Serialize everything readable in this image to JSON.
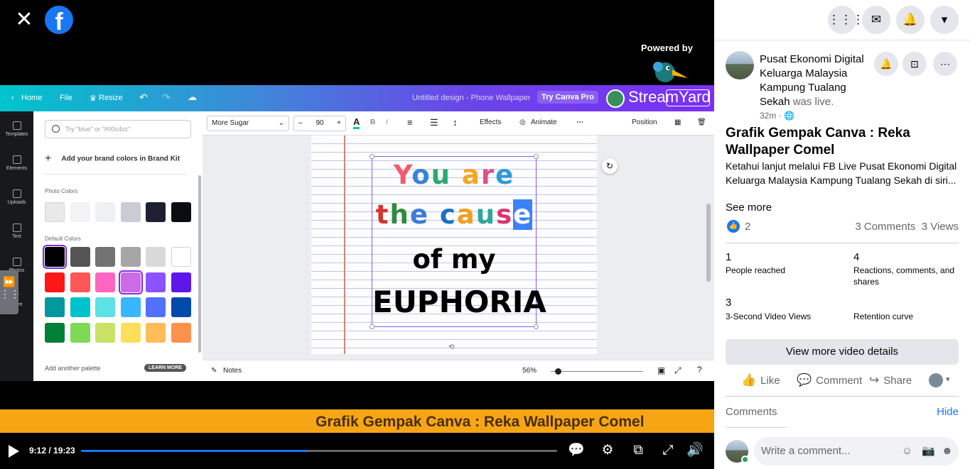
{
  "viewer": {
    "close_icon": "close-icon",
    "logo": "facebook-logo",
    "powered_by": "Powered by",
    "streamyard_text": "StreamYard"
  },
  "canva": {
    "home": "Home",
    "file": "File",
    "resize": "Resize",
    "doc_title": "Untitled design - Phone Wallpaper",
    "try_pro": "Try Canva Pro",
    "rail": [
      "Templates",
      "Elements",
      "Uploads",
      "Text",
      "Photos",
      "More"
    ],
    "search_placeholder": "Try \"blue\" or \"#00c4cc\"",
    "brand_kit": "Add your brand colors in Brand Kit",
    "photo_colors_label": "Photo Colors",
    "photo_colors": [
      "#e9e9ea",
      "#f3f3f5",
      "#eef0f2",
      "#cacbd4",
      "#1d2030",
      "#0b0b12"
    ],
    "default_colors_label": "Default Colors",
    "default_colors": [
      [
        "#000000",
        "#545454",
        "#737373",
        "#a6a6a6",
        "#d9d9d9",
        "#ffffff"
      ],
      [
        "#ff1616",
        "#ff5757",
        "#ff66c4",
        "#cb6ce6",
        "#8c52ff",
        "#5e17eb"
      ],
      [
        "#03989e",
        "#00c2cb",
        "#5ce1e6",
        "#38b6ff",
        "#5271ff",
        "#004aad"
      ],
      [
        "#008037",
        "#7ed957",
        "#c9e265",
        "#ffde59",
        "#ffbd59",
        "#ff914d"
      ]
    ],
    "selected_color": "#cb6ce6",
    "add_palette": "Add another palette",
    "learn_more": "LEARN MORE",
    "font_name": "More Sugar",
    "font_size": "90",
    "effects": "Effects",
    "animate": "Animate",
    "position": "Position",
    "notes": "Notes",
    "zoom": "56%",
    "text_lines": {
      "line1": [
        [
          "Y",
          "#f25a6b"
        ],
        [
          "o",
          "#3b82d6"
        ],
        [
          "u",
          "#2ba86e"
        ],
        [
          " ",
          "#000"
        ],
        [
          "a",
          "#f5a623"
        ],
        [
          "r",
          "#e04f8a"
        ],
        [
          "e",
          "#2d9bd6"
        ]
      ],
      "line2": [
        [
          "t",
          "#d6332a"
        ],
        [
          "h",
          "#2e8b3d"
        ],
        [
          "e",
          "#3b7bd6"
        ],
        [
          " ",
          "#000"
        ],
        [
          "c",
          "#1e6fc4"
        ],
        [
          "a",
          "#f0a020"
        ],
        [
          "u",
          "#2ca89a"
        ],
        [
          "s",
          "#d9386b"
        ]
      ],
      "line2_cursor": "e",
      "line3": "of my",
      "line4": "EUPHORIA"
    }
  },
  "banner": {
    "text": "Grafik Gempak Canva : Reka Wallpaper Comel",
    "color": "#f6a515"
  },
  "player": {
    "time": "9:12 / 19:23",
    "progress": 0.474
  },
  "topbar_icons": [
    "menu-grid-icon",
    "messenger-icon",
    "notifications-icon",
    "account-dropdown-icon"
  ],
  "post": {
    "page_name": "Pusat Ekonomi Digital Keluarga Malaysia Kampung Tualang Sekah",
    "was_live": "was live.",
    "time_ago": "32m ·",
    "title": "Grafik Gempak Canva : Reka Wallpaper Comel",
    "description": "Ketahui lanjut melalui FB Live Pusat Ekonomi Digital Keluarga Malaysia Kampung Tualang Sekah di siri...",
    "see_more": "See more",
    "like_count": "2",
    "comments_count": "3 Comments",
    "views_count": "3 Views",
    "metrics": [
      {
        "value": "1",
        "label": "People reached"
      },
      {
        "value": "4",
        "label": "Reactions, comments, and shares"
      },
      {
        "value": "3",
        "label": "3-Second Video Views"
      },
      {
        "value": "",
        "label": "Retention curve"
      }
    ],
    "view_more": "View more video details",
    "like": "Like",
    "comment": "Comment",
    "share": "Share",
    "comments_header": "Comments",
    "hide": "Hide",
    "comment_placeholder": "Write a comment..."
  }
}
